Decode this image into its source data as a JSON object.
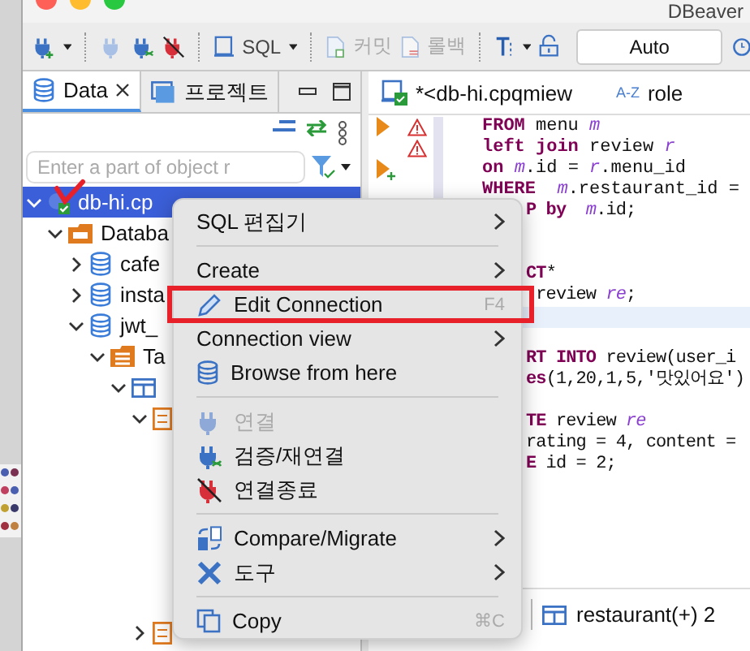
{
  "window": {
    "title": "DBeaver"
  },
  "toolbar": {
    "sql_label": "SQL",
    "commit": {
      "label": "커밋",
      "disabled": true
    },
    "rollback": {
      "label": "롤백",
      "disabled": true
    },
    "transaction_mode": "Auto"
  },
  "navigator": {
    "tabs": [
      {
        "label": "Data",
        "selected": true
      },
      {
        "label": "프로젝트",
        "selected": false
      }
    ],
    "search": {
      "placeholder": "Enter a part of object r"
    },
    "tree": [
      {
        "label": "db-hi.cp",
        "kind": "connection",
        "expanded": true,
        "selected": true,
        "children": [
          {
            "label": "Databa",
            "kind": "folder",
            "expanded": true,
            "selected": false,
            "children": [
              {
                "label": "cafe",
                "kind": "database",
                "expanded": false,
                "selected": false
              },
              {
                "label": "insta",
                "kind": "database",
                "expanded": false,
                "selected": false
              },
              {
                "label": "jwt_",
                "kind": "database",
                "expanded": true,
                "selected": false,
                "children": [
                  {
                    "label": "Ta",
                    "kind": "tables",
                    "expanded": true,
                    "selected": false,
                    "children": [
                      {
                        "kind": "table",
                        "expanded": true,
                        "selected": false,
                        "children": [
                          {
                            "kind": "columns",
                            "expanded": true,
                            "selected": false
                          },
                          {
                            "kind": "columns",
                            "expanded": false,
                            "selected": false
                          }
                        ]
                      }
                    ]
                  }
                ]
              }
            ]
          }
        ]
      }
    ]
  },
  "editor": {
    "tab": {
      "title": "*<db-hi.cpqmiew",
      "sort_label": "A-Z",
      "role": "role"
    },
    "lines": [
      {
        "keyword": "FROM",
        "text": " menu *m*",
        "runnable": true,
        "added": false,
        "warning": true
      },
      {
        "keyword": "left join",
        "text": " review *r*",
        "runnable": false,
        "warning": true
      },
      {
        "keyword": "on",
        "text": " *m*.id = *r*.menu_id",
        "runnable": true,
        "added": true,
        "warning": false
      },
      {
        "keyword": "WHERE",
        "text": "  *m*.restaurant_id =",
        "runnable": false,
        "warning": false
      }
    ],
    "side_lines": [
      {
        "keyword": "P by",
        "text": "  *m*.id;",
        "current": false
      },
      {
        "current": false
      },
      {
        "current": false
      },
      {
        "keyword": "CT",
        "text": "*",
        "current": false
      },
      {
        "text": " review *re*;",
        "current": false
      },
      {
        "current": true
      },
      {
        "current": false
      },
      {
        "keyword": "RT INTO",
        "text": " review(user_i",
        "current": false
      },
      {
        "keyword": "es",
        "text": "(1,20,1,5,'맛있어요')",
        "current": false
      },
      {
        "current": false
      },
      {
        "keyword": "TE",
        "text": " review *re*",
        "current": false
      },
      {
        "text": "rating = 4, content =",
        "current": false
      },
      {
        "keyword": "E",
        "text": " id = 2;",
        "current": false
      }
    ],
    "results": {
      "tab": "restaurant(+) 2"
    }
  },
  "context_menu": {
    "items": [
      {
        "kind": "item",
        "label": "SQL 편집기",
        "submenu": true,
        "disabled": false,
        "marked": false
      },
      {
        "kind": "separator"
      },
      {
        "kind": "item",
        "label": "Create",
        "submenu": true,
        "disabled": false,
        "marked": false
      },
      {
        "kind": "item",
        "label": "Edit Connection",
        "shortcut": "F4",
        "submenu": false,
        "disabled": false,
        "marked": true
      },
      {
        "kind": "item",
        "label": "Connection view",
        "submenu": true,
        "disabled": false,
        "marked": false
      },
      {
        "kind": "item",
        "label": "Browse from here",
        "submenu": false,
        "disabled": false,
        "marked": false
      },
      {
        "kind": "separator"
      },
      {
        "kind": "item",
        "label": "연결",
        "submenu": false,
        "disabled": true,
        "marked": false
      },
      {
        "kind": "item",
        "label": "검증/재연결",
        "submenu": false,
        "disabled": false,
        "marked": false
      },
      {
        "kind": "item",
        "label": "연결종료",
        "submenu": false,
        "disabled": false,
        "marked": false
      },
      {
        "kind": "separator"
      },
      {
        "kind": "item",
        "label": "Compare/Migrate",
        "submenu": true,
        "disabled": false,
        "marked": false
      },
      {
        "kind": "item",
        "label": "도구",
        "submenu": true,
        "disabled": false,
        "marked": false
      },
      {
        "kind": "separator"
      },
      {
        "kind": "item",
        "label": "Copy",
        "shortcut": "⌘C",
        "submenu": false,
        "disabled": false,
        "marked": false
      }
    ]
  }
}
